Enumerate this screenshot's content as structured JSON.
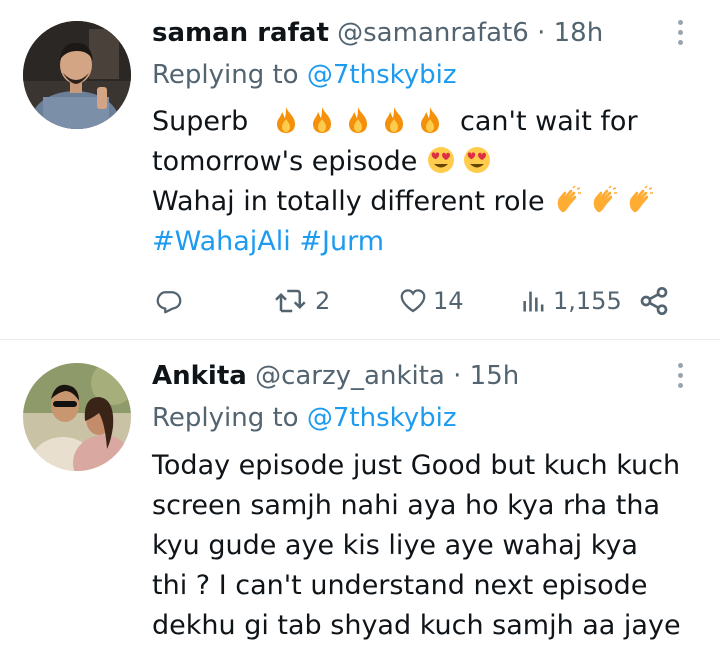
{
  "tweets": [
    {
      "name": "saman rafat",
      "handle": "@samanrafat6",
      "dot": "·",
      "time": "18h",
      "replying_prefix": "Replying to ",
      "replying_to": "@7thskybiz",
      "line1_a": "Superb",
      "line1_b": "can't wait for",
      "line2": "tomorrow's episode",
      "line3": "Wahaj in totally different role",
      "hashtag1": "#WahajAli",
      "hashtag2": "#Jurm",
      "retweets": "2",
      "likes": "14",
      "views": "1,155"
    },
    {
      "name": "Ankita",
      "handle": "@carzy_ankita",
      "dot": "·",
      "time": "15h",
      "replying_prefix": "Replying to ",
      "replying_to": "@7thskybiz",
      "lines": [
        "Today episode just Good but kuch kuch",
        "screen samjh nahi aya ho kya rha tha",
        "kyu gude aye kis liye aye wahaj kya",
        "thi ? I can't understand next episode",
        "dekhu gi tab shyad kuch samjh aa jaye"
      ]
    }
  ],
  "colors": {
    "text": "#0f1419",
    "muted": "#536471",
    "link": "#1d9bf0",
    "divider": "#e7e9ea"
  },
  "icons": [
    "fire-icon",
    "heart-eyes-icon",
    "clapping-hands-icon",
    "reply-icon",
    "retweet-icon",
    "like-icon",
    "views-icon",
    "share-icon",
    "more-icon"
  ]
}
